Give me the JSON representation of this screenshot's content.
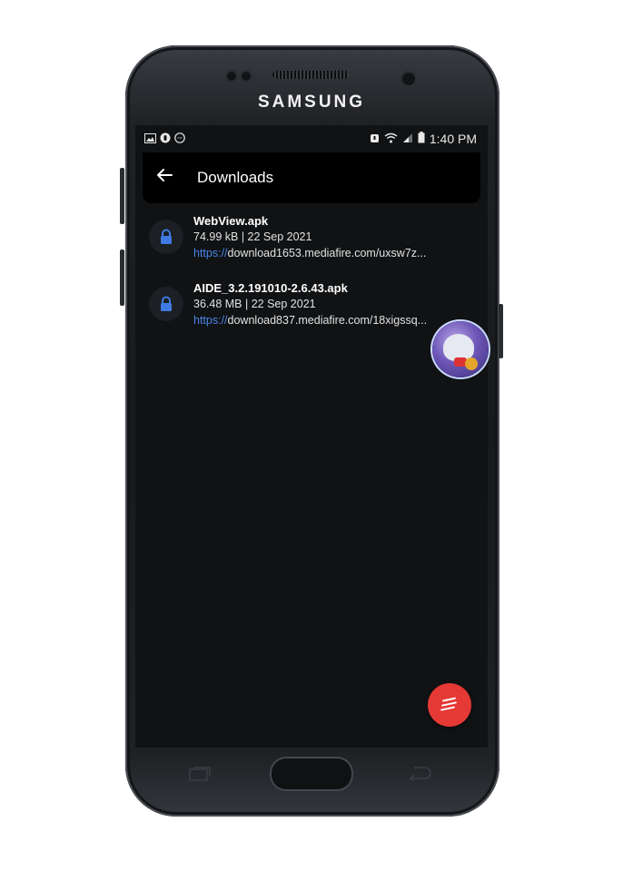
{
  "device": {
    "brand": "SAMSUNG"
  },
  "status_bar": {
    "time": "1:40 PM"
  },
  "app_bar": {
    "title": "Downloads"
  },
  "downloads": [
    {
      "name": "WebView.apk",
      "meta": "74.99 kB | 22 Sep 2021",
      "url_scheme": "https://",
      "url_rest": "download1653.mediafire.com/uxsw7z..."
    },
    {
      "name": "AIDE_3.2.191010-2.6.43.apk",
      "meta": "36.48 MB | 22 Sep 2021",
      "url_scheme": "https://",
      "url_rest": "download837.mediafire.com/18xigssq..."
    }
  ],
  "colors": {
    "fab": "#e53935",
    "link": "#4a86e8",
    "lock_icon": "#3f7be3",
    "background": "#101214"
  },
  "icons": [
    "back-arrow-icon",
    "lock-icon",
    "sort-list-icon",
    "gallery-icon",
    "messenger-icon",
    "wifi-icon",
    "signal-icon",
    "battery-icon"
  ]
}
